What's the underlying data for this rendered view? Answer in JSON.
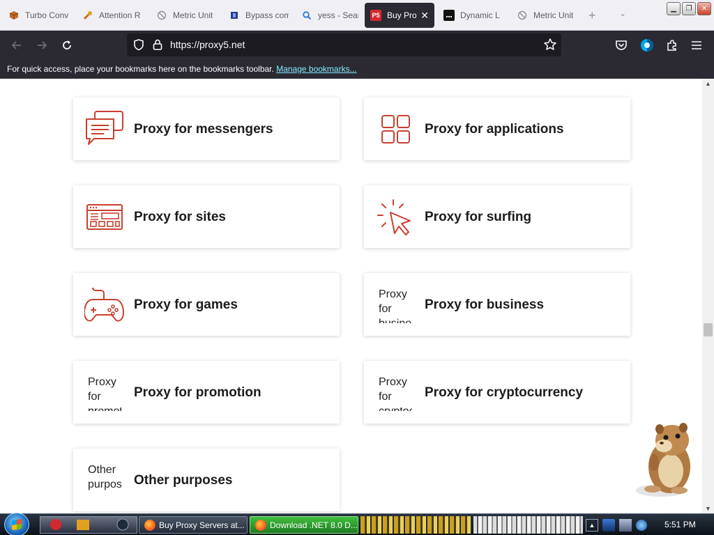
{
  "browser": {
    "tabs": [
      {
        "label": "Turbo Conv",
        "icon": "box-icon",
        "color": "#c46b2b"
      },
      {
        "label": "Attention R",
        "icon": "tools-icon",
        "color": "#d06b20"
      },
      {
        "label": "Metric Unit",
        "icon": "ban-icon",
        "color": "#8f8f9d"
      },
      {
        "label": "Bypass com",
        "icon": "bookmark-icon",
        "color": "#2a3a8a"
      },
      {
        "label": "yess - Sear",
        "icon": "search-icon",
        "color": "#2a7ad6"
      },
      {
        "label": "Buy Prox",
        "icon": "p5-icon",
        "color": "#d6292f",
        "active": true
      },
      {
        "label": "Dynamic L",
        "icon": "app-icon",
        "color": "#111111"
      },
      {
        "label": "Metric Unit",
        "icon": "ban-icon",
        "color": "#8f8f9d"
      }
    ],
    "new_tab": "+",
    "url": "https://proxy5.net",
    "bookmarks_text": "For quick access, place your bookmarks here on the bookmarks toolbar.",
    "manage_bookmarks": "Manage bookmarks..."
  },
  "accent_color": "#c8402f",
  "cards": [
    {
      "title": "Proxy for messengers",
      "icon": "chat-bubbles-icon"
    },
    {
      "title": "Proxy for applications",
      "icon": "grid-icon"
    },
    {
      "title": "Proxy for sites",
      "icon": "website-icon"
    },
    {
      "title": "Proxy for surfing",
      "icon": "cursor-click-icon"
    },
    {
      "title": "Proxy for games",
      "icon": "gamepad-icon"
    },
    {
      "title": "Proxy for business",
      "alt": "Proxy for business"
    },
    {
      "title": "Proxy for promotion",
      "alt": "Proxy for promotion"
    },
    {
      "title": "Proxy for cryptocurrency",
      "alt": "Proxy for cryptocurrency"
    },
    {
      "title": "Other purposes",
      "alt": "Other purposes"
    }
  ],
  "taskbar": {
    "tasks": [
      {
        "label": "Buy Proxy Servers at..."
      },
      {
        "label": "Download .NET 8.0 D..."
      }
    ],
    "clock": "5:51 PM"
  }
}
